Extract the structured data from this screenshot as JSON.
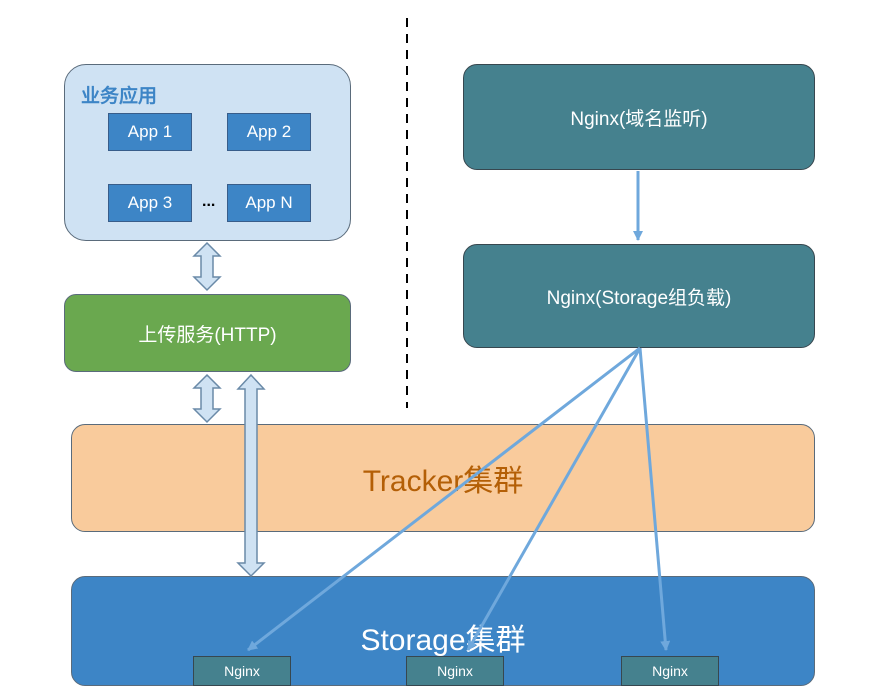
{
  "business": {
    "title": "业务应用",
    "apps": [
      "App 1",
      "App 2",
      "App 3",
      "App N"
    ],
    "ellipsis": "..."
  },
  "upload_service": {
    "label": "上传服务(HTTP)"
  },
  "nginx_domain": {
    "label": "Nginx(域名监听)"
  },
  "nginx_storage_lb": {
    "label": "Nginx(Storage组负载)"
  },
  "tracker_cluster": {
    "label": "Tracker集群"
  },
  "storage_cluster": {
    "label": "Storage集群",
    "nginx_nodes": [
      "Nginx",
      "Nginx",
      "Nginx"
    ]
  },
  "colors": {
    "business_bg": "#cfe2f3",
    "app_bg": "#3d85c6",
    "upload_bg": "#6aa84f",
    "nginx_bg": "#45818e",
    "tracker_bg": "#f9cb9c",
    "tracker_text": "#b45f06",
    "storage_bg": "#3d85c6",
    "arrow": "#6fa8dc"
  }
}
